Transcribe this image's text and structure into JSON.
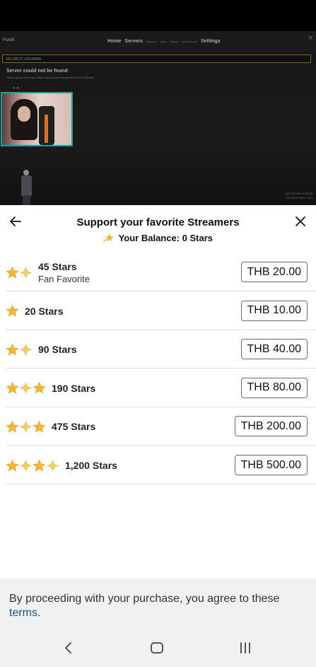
{
  "game": {
    "logo": "FiveM",
    "nav": [
      "Home",
      "Servers"
    ],
    "nav_small": [
      "Supporters",
      "History",
      "Favorites",
      "Recent Servers"
    ],
    "nav_settings": "Settings",
    "address": "103.208.27.203:40096",
    "error_title": "Server could not be found",
    "error_text": "Server query timed out. Make sure you've entered the correct address.",
    "watermark": "CAR REMAP ENGINE\nSATAN UPTALK 1283"
  },
  "sheet": {
    "title": "Support your favorite Streamers",
    "balance_label": "Your Balance:",
    "balance_value": "0 Stars"
  },
  "tiers": [
    {
      "amount": "45 Stars",
      "sub": "Fan Favorite",
      "price": "THB 20.00",
      "icons": [
        "star-icon",
        "sparkle-icon"
      ]
    },
    {
      "amount": "20 Stars",
      "sub": "",
      "price": "THB 10.00",
      "icons": [
        "star-icon"
      ]
    },
    {
      "amount": "90 Stars",
      "sub": "",
      "price": "THB 40.00",
      "icons": [
        "star-icon",
        "sparkle-icon"
      ]
    },
    {
      "amount": "190 Stars",
      "sub": "",
      "price": "THB 80.00",
      "icons": [
        "star-icon",
        "sparkle-icon",
        "star-icon"
      ]
    },
    {
      "amount": "475 Stars",
      "sub": "",
      "price": "THB 200.00",
      "icons": [
        "star-icon",
        "sparkle-icon",
        "star-icon"
      ]
    },
    {
      "amount": "1,200 Stars",
      "sub": "",
      "price": "THB 500.00",
      "icons": [
        "star-icon",
        "sparkle-icon",
        "star-icon",
        "sparkle-icon"
      ]
    }
  ],
  "terms": {
    "text": "By proceeding with your purchase, you agree to these ",
    "link": "terms",
    "end": "."
  },
  "colors": {
    "star": "#f5b731",
    "link": "#1b4f8a",
    "webcam_border": "#1aa0a0"
  }
}
